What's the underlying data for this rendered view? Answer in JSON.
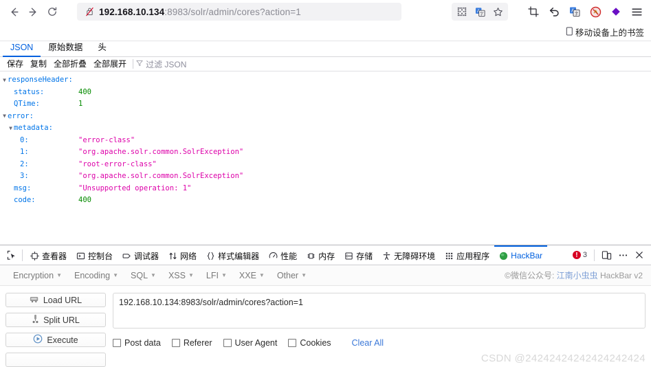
{
  "browser": {
    "back_icon": "back-arrow-icon",
    "forward_icon": "forward-arrow-icon",
    "reload_icon": "reload-icon",
    "url_host": "192.168.10.134",
    "url_rest": ":8983/solr/admin/cores?action=1",
    "url_full": "192.168.10.134:8983/solr/admin/cores?action=1",
    "security_icon": "insecure-lock-icon",
    "right_icons": [
      "qr-code-icon",
      "translate-page-icon",
      "bookmark-star-icon"
    ],
    "ext_icons": [
      "screenshot-crop-icon",
      "undo-arrow-icon",
      "translate-icon",
      "adblock-icon",
      "extension-diamond-icon",
      "app-menu-icon"
    ],
    "bookmark_item": "移动设备上的书签"
  },
  "json_viewer": {
    "tabs": [
      {
        "label": "JSON",
        "active": true
      },
      {
        "label": "原始数据",
        "active": false
      },
      {
        "label": "头",
        "active": false
      }
    ],
    "tools": [
      "保存",
      "复制",
      "全部折叠",
      "全部展开"
    ],
    "filter_icon": "filter-funnel-icon",
    "filter_placeholder": "过滤 JSON",
    "rows": [
      {
        "indent": 0,
        "twisty": "▼",
        "key": "responseHeader:",
        "value": "",
        "type": "none"
      },
      {
        "indent": 1,
        "twisty": "",
        "key": "status:",
        "value": "400",
        "type": "number"
      },
      {
        "indent": 1,
        "twisty": "",
        "key": "QTime:",
        "value": "1",
        "type": "number"
      },
      {
        "indent": 0,
        "twisty": "▼",
        "key": "error:",
        "value": "",
        "type": "none"
      },
      {
        "indent": 1,
        "twisty": "▼",
        "key": "metadata:",
        "value": "",
        "type": "none"
      },
      {
        "indent": 2,
        "twisty": "",
        "key": "0:",
        "value": "\"error-class\"",
        "type": "string"
      },
      {
        "indent": 2,
        "twisty": "",
        "key": "1:",
        "value": "\"org.apache.solr.common.SolrException\"",
        "type": "string"
      },
      {
        "indent": 2,
        "twisty": "",
        "key": "2:",
        "value": "\"root-error-class\"",
        "type": "string"
      },
      {
        "indent": 2,
        "twisty": "",
        "key": "3:",
        "value": "\"org.apache.solr.common.SolrException\"",
        "type": "string"
      },
      {
        "indent": 1,
        "twisty": "",
        "key": "msg:",
        "value": "\"Unsupported operation: 1\"",
        "type": "string"
      },
      {
        "indent": 1,
        "twisty": "",
        "key": "code:",
        "value": "400",
        "type": "number"
      }
    ]
  },
  "devtools": {
    "picker_icon": "element-picker-icon",
    "tabs": [
      {
        "label": "查看器",
        "icon": "inspector-icon",
        "active": false
      },
      {
        "label": "控制台",
        "icon": "console-icon",
        "active": false
      },
      {
        "label": "调试器",
        "icon": "debugger-icon",
        "active": false
      },
      {
        "label": "网络",
        "icon": "network-icon",
        "active": false
      },
      {
        "label": "样式编辑器",
        "icon": "style-editor-icon",
        "active": false
      },
      {
        "label": "性能",
        "icon": "performance-icon",
        "active": false
      },
      {
        "label": "内存",
        "icon": "memory-icon",
        "active": false
      },
      {
        "label": "存储",
        "icon": "storage-icon",
        "active": false
      },
      {
        "label": "无障碍环境",
        "icon": "accessibility-icon",
        "active": false
      },
      {
        "label": "应用程序",
        "icon": "application-icon",
        "active": false
      },
      {
        "label": "HackBar",
        "icon": "hackbar-icon",
        "active": true
      }
    ],
    "error_count": "3",
    "error_icon": "error-circle-icon",
    "responsive_icon": "responsive-design-icon",
    "meatball_icon": "more-options-icon",
    "close_icon": "close-icon"
  },
  "hackbar": {
    "menus": [
      "Encryption",
      "Encoding",
      "SQL",
      "XSS",
      "LFI",
      "XXE",
      "Other"
    ],
    "copyright_prefix": "©微信公众号: ",
    "copyright_cn": "江南小虫虫",
    "copyright_suffix": " HackBar v2",
    "buttons": [
      {
        "label": "Load URL",
        "icon": "load-url-icon"
      },
      {
        "label": "Split URL",
        "icon": "split-url-icon"
      },
      {
        "label": "Execute",
        "icon": "execute-play-icon"
      }
    ],
    "url_value": "192.168.10.134:8983/solr/admin/cores?action=1",
    "checkboxes": [
      "Post data",
      "Referer",
      "User Agent",
      "Cookies"
    ],
    "clear_all": "Clear All"
  },
  "watermark": "CSDN @24242424242424242424",
  "colors": {
    "accent": "#0060df",
    "json_key": "#0074e8",
    "json_string": "#dd00a9",
    "json_number": "#058b00",
    "error_red": "#d70022",
    "link_blue": "#3b78d8"
  }
}
